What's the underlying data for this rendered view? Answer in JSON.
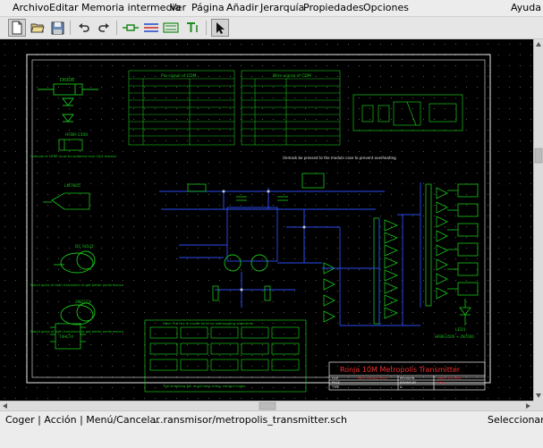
{
  "menubar": {
    "items": [
      "Archivo",
      "Editar",
      "Memoria intermedia",
      "Ver",
      "Página",
      "Añadir",
      "Jerarquía",
      "Propiedades",
      "Opciones"
    ],
    "help": "Ayuda"
  },
  "toolbar": {
    "buttons": [
      "new-icon",
      "open-icon",
      "save-icon",
      "undo-icon",
      "redo-icon",
      "add-component-icon",
      "add-net-icon",
      "add-bus-icon",
      "add-text-icon",
      "select-icon"
    ]
  },
  "schematic": {
    "title_block": {
      "title": "Ronja 10M Metropolis Transmitter",
      "row_labels": [
        "FILE",
        "PAGE",
        "TYPE"
      ],
      "fields": [
        "REVISION",
        "DRAWN BY",
        "0"
      ],
      "values": [
        "Karel Kulhavy 2002",
        "March 23, 2002",
        "Ronja"
      ]
    },
    "tables": [
      {
        "title": "Pin-signal of CDM"
      },
      {
        "title": "Wire-signal of CDM"
      }
    ],
    "labels": {
      "diode": "DIODE",
      "hfbr": "HFBR-1500",
      "lm7805": "LM7805",
      "dc_note": "DC SOLD",
      "reg": "2N2222",
      "ttl": "74HC74",
      "transistor_note": "Match gains of both transistors to get better performance",
      "transistor_note2": "Match gains of both transistors to get better performance",
      "led_note": "Cathode of HFBR must be soldered near 1K/4 resistor",
      "power_note": "Unmask be pressed to the module case to prevent overheating",
      "bottom_note": "Hole: Put the ic inside form no overlapping segments",
      "bottom_note2": "The shielding foil must have many contact holes",
      "led_label": "LED1",
      "hfbr_right": "HFBR-2500 + 2N7000"
    }
  },
  "status": {
    "left": "Coger | Acción | Menú/Cancelar",
    "file": "...ransmisor/metropolis_transmitter.sch",
    "mode": "Seleccionar"
  }
}
